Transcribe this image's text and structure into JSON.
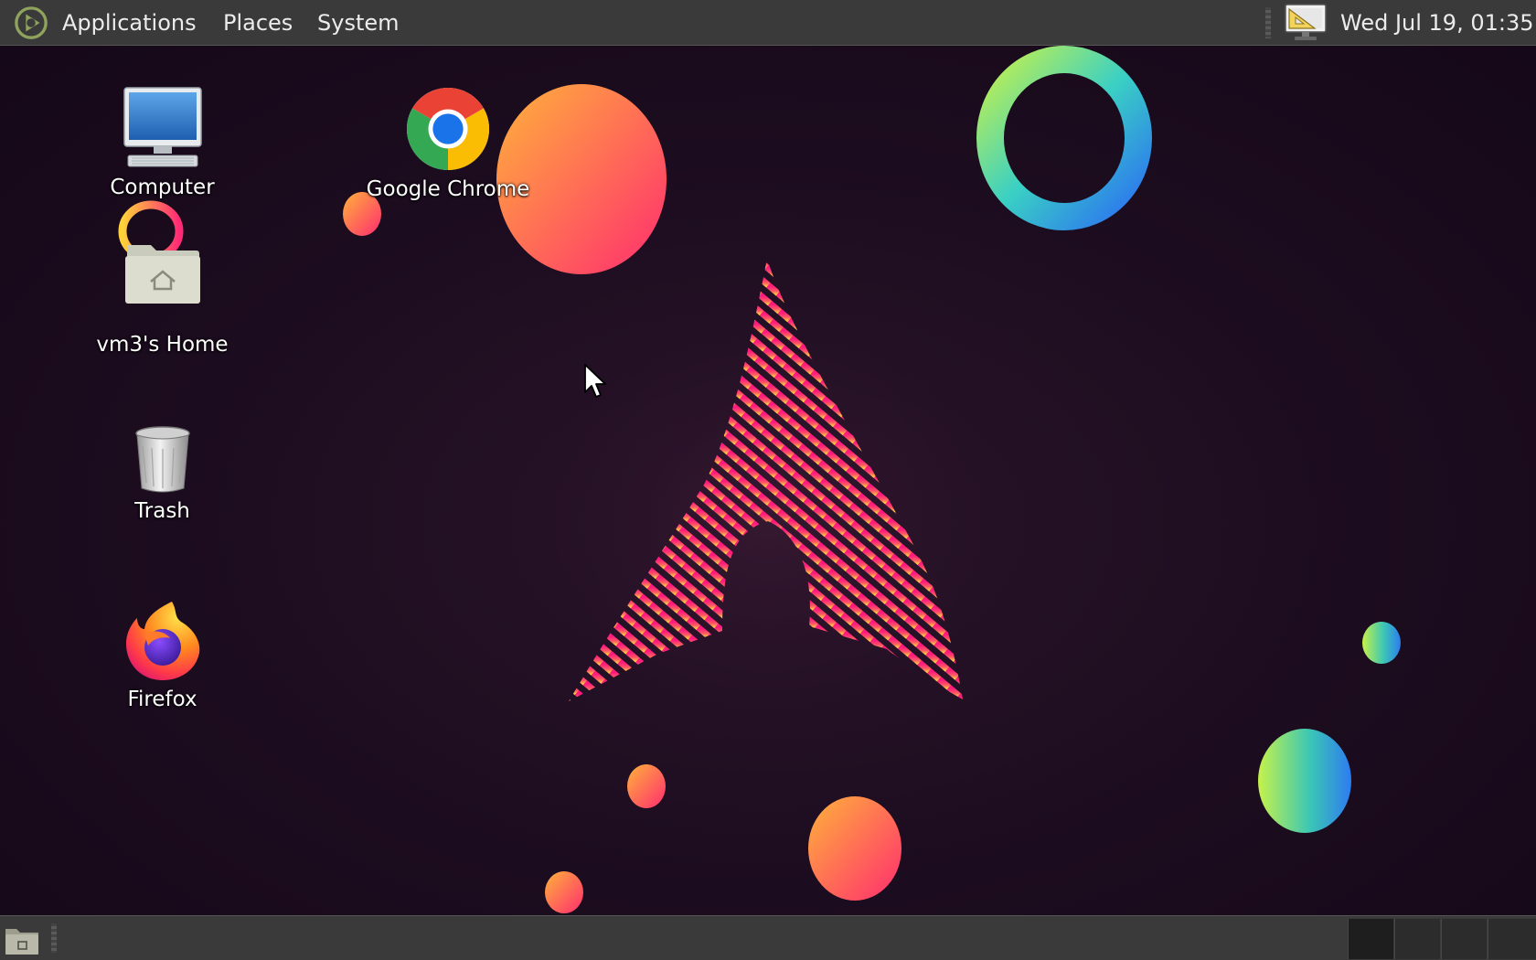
{
  "top_panel": {
    "menus": [
      "Applications",
      "Places",
      "System"
    ],
    "logo_icon": "mate-menu-icon",
    "tray_icon": "display-settings-icon",
    "clock": "Wed Jul 19, 01:35"
  },
  "desktop": {
    "icons": [
      {
        "label": "Computer",
        "icon": "computer-icon"
      },
      {
        "label": "Google Chrome",
        "icon": "chrome-icon"
      },
      {
        "label": "vm3's Home",
        "icon": "home-folder-icon"
      },
      {
        "label": "Trash",
        "icon": "trash-icon"
      },
      {
        "label": "Firefox",
        "icon": "firefox-icon"
      }
    ],
    "wallpaper": "arch-linux-logo-with-gradient-bubbles"
  },
  "bottom_panel": {
    "show_desktop_icon": "show-desktop-icon",
    "workspace_count": 4,
    "active_workspace": 1
  },
  "colors": {
    "panel_bg": "#3a3a3a",
    "desktop_bg": "#1c0c1f",
    "accent_pink": "#ff1f7a",
    "accent_orange": "#ffa62b"
  }
}
